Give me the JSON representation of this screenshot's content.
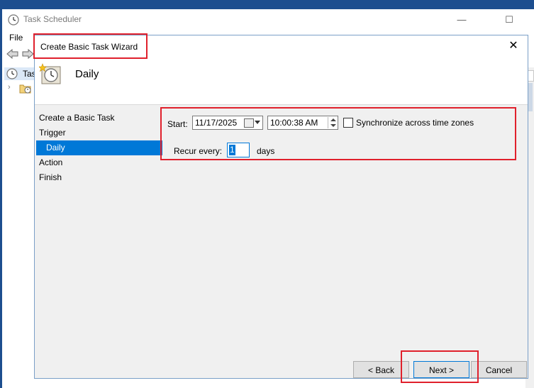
{
  "parent_window": {
    "title": "Task Scheduler",
    "minimize_glyph": "—",
    "maximize_glyph": "☐",
    "menu_file": "File",
    "tree_root_label": "Tas"
  },
  "wizard": {
    "title": "Create Basic Task Wizard",
    "close_glyph": "✕",
    "header_title": "Daily",
    "steps": [
      {
        "label": "Create a Basic Task"
      },
      {
        "label": "Trigger"
      },
      {
        "label": "Daily"
      },
      {
        "label": "Action"
      },
      {
        "label": "Finish"
      }
    ],
    "start_label": "Start:",
    "start_date": "11/17/2025",
    "start_time": "10:00:38 AM",
    "sync_label": "Synchronize across time zones",
    "sync_checked": false,
    "recur_label": "Recur every:",
    "recur_value": "1",
    "recur_unit": "days",
    "back_button": "< Back",
    "next_button": "Next >",
    "cancel_button": "Cancel"
  },
  "colors": {
    "highlight": "#e0202c",
    "accent": "#0078d7",
    "desktop": "#1d4e8f"
  },
  "icons": [
    "clock-icon",
    "back-arrow-icon",
    "forward-arrow-icon",
    "folder-clock-icon",
    "calendar-icon",
    "wizard-clock-icon"
  ]
}
